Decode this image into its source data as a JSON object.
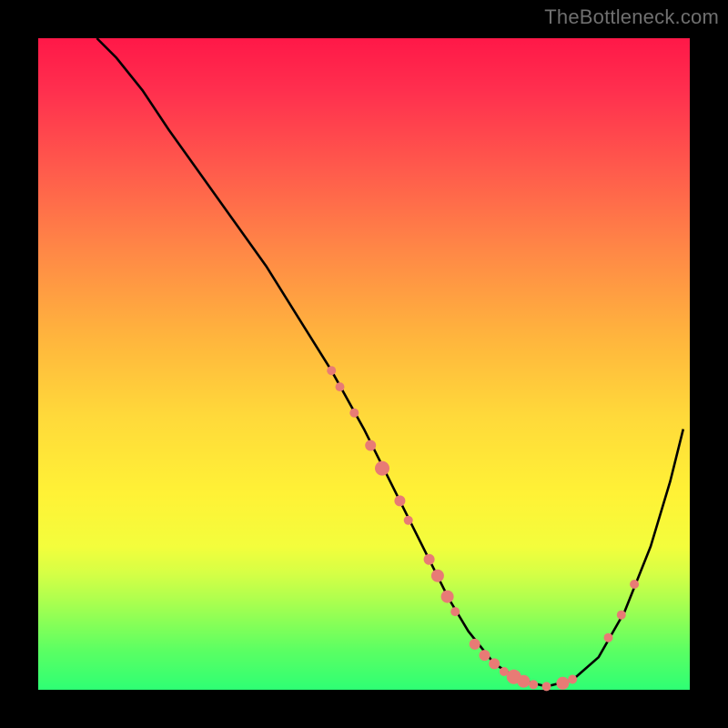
{
  "watermark": "TheBottleneck.com",
  "colors": {
    "background": "#000000",
    "curve": "#000000",
    "marker": "#e87b75",
    "gradient_top": "#ff1848",
    "gradient_bottom": "#2eff74"
  },
  "chart_data": {
    "type": "line",
    "title": "",
    "xlabel": "",
    "ylabel": "",
    "xlim": [
      0,
      100
    ],
    "ylim": [
      0,
      100
    ],
    "grid": false,
    "annotations": [],
    "series": [
      {
        "name": "curve",
        "x": [
          9,
          12,
          16,
          20,
          25,
          30,
          35,
          40,
          45,
          50,
          55,
          58,
          60,
          63,
          66,
          70,
          74,
          78,
          82,
          86,
          90,
          94,
          97,
          99
        ],
        "y": [
          100,
          97,
          92,
          86,
          79,
          72,
          65,
          57,
          49,
          40,
          30,
          24,
          20,
          14,
          9,
          4,
          1.5,
          0.5,
          1.5,
          5,
          12,
          22,
          32,
          40
        ]
      }
    ],
    "markers": [
      {
        "x": 45.0,
        "y": 49.0,
        "r": 5
      },
      {
        "x": 46.3,
        "y": 46.5,
        "r": 5
      },
      {
        "x": 48.5,
        "y": 42.5,
        "r": 5
      },
      {
        "x": 51.0,
        "y": 37.5,
        "r": 6
      },
      {
        "x": 52.8,
        "y": 34.0,
        "r": 8
      },
      {
        "x": 55.5,
        "y": 29.0,
        "r": 6
      },
      {
        "x": 56.8,
        "y": 26.0,
        "r": 5
      },
      {
        "x": 60.0,
        "y": 20.0,
        "r": 6
      },
      {
        "x": 61.3,
        "y": 17.5,
        "r": 7
      },
      {
        "x": 62.8,
        "y": 14.3,
        "r": 7
      },
      {
        "x": 64.0,
        "y": 12.0,
        "r": 5
      },
      {
        "x": 67.0,
        "y": 7.0,
        "r": 6
      },
      {
        "x": 68.5,
        "y": 5.3,
        "r": 6
      },
      {
        "x": 70.0,
        "y": 4.0,
        "r": 6
      },
      {
        "x": 71.5,
        "y": 2.8,
        "r": 5
      },
      {
        "x": 73.0,
        "y": 2.0,
        "r": 8
      },
      {
        "x": 74.5,
        "y": 1.3,
        "r": 7
      },
      {
        "x": 76.0,
        "y": 0.8,
        "r": 5
      },
      {
        "x": 78.0,
        "y": 0.5,
        "r": 5
      },
      {
        "x": 80.5,
        "y": 1.0,
        "r": 7
      },
      {
        "x": 82.0,
        "y": 1.6,
        "r": 5
      },
      {
        "x": 87.5,
        "y": 8.0,
        "r": 5
      },
      {
        "x": 89.5,
        "y": 11.5,
        "r": 5
      },
      {
        "x": 91.5,
        "y": 16.2,
        "r": 5
      }
    ]
  }
}
